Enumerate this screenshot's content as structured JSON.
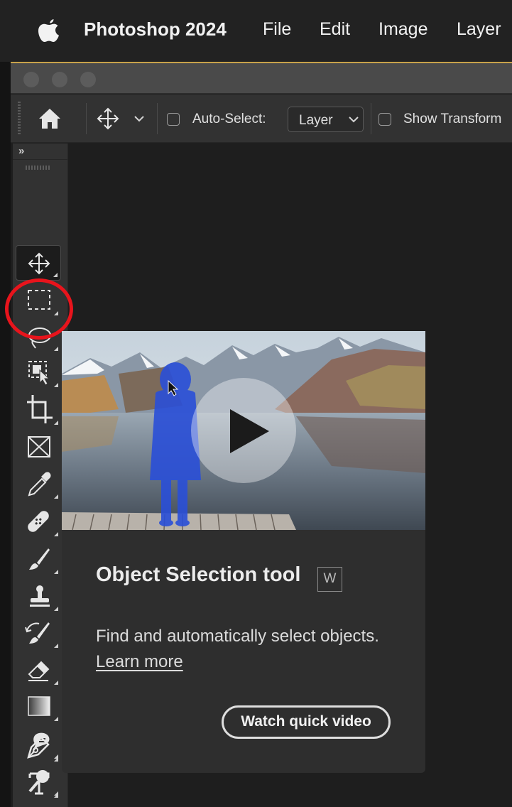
{
  "menubar": {
    "apple_icon": "apple-logo-icon",
    "app_name": "Photoshop 2024",
    "items": [
      "File",
      "Edit",
      "Image",
      "Layer"
    ]
  },
  "options_bar": {
    "home_icon": "home-icon",
    "move_icon": "move-icon",
    "auto_select_label": "Auto-Select:",
    "auto_select_value": "Layer",
    "show_transform_label": "Show Transform"
  },
  "toolbar": {
    "collapse_label": "»",
    "tools": [
      {
        "name": "move-tool",
        "icon": "move-icon",
        "active": true
      },
      {
        "name": "rectangular-marquee-tool",
        "icon": "marquee-icon"
      },
      {
        "name": "lasso-tool",
        "icon": "lasso-icon"
      },
      {
        "name": "object-selection-tool",
        "icon": "object-selection-icon",
        "highlighted": true
      },
      {
        "name": "crop-tool",
        "icon": "crop-icon"
      },
      {
        "name": "frame-tool",
        "icon": "frame-icon"
      },
      {
        "name": "eyedropper-tool",
        "icon": "eyedropper-icon"
      },
      {
        "name": "healing-brush-tool",
        "icon": "bandage-icon"
      },
      {
        "name": "brush-tool",
        "icon": "brush-icon"
      },
      {
        "name": "clone-stamp-tool",
        "icon": "stamp-icon"
      },
      {
        "name": "history-brush-tool",
        "icon": "history-brush-icon"
      },
      {
        "name": "eraser-tool",
        "icon": "eraser-icon"
      },
      {
        "name": "gradient-tool",
        "icon": "gradient-icon"
      },
      {
        "name": "smudge-tool",
        "icon": "smudge-icon"
      },
      {
        "name": "dodge-tool",
        "icon": "dodge-icon"
      },
      {
        "name": "pen-tool",
        "icon": "pen-icon"
      },
      {
        "name": "type-tool",
        "icon": "type-icon"
      }
    ]
  },
  "tooltip_card": {
    "title": "Object Selection tool",
    "shortcut": "W",
    "description": "Find and automatically select objects.",
    "learn_more": "Learn more",
    "video_button": "Watch quick video",
    "play_icon": "play-icon"
  },
  "colors": {
    "highlight_ring": "#e8141c",
    "selection_overlay": "#2a4fd8",
    "panel": "#323232",
    "canvas": "#1e1e1e"
  }
}
